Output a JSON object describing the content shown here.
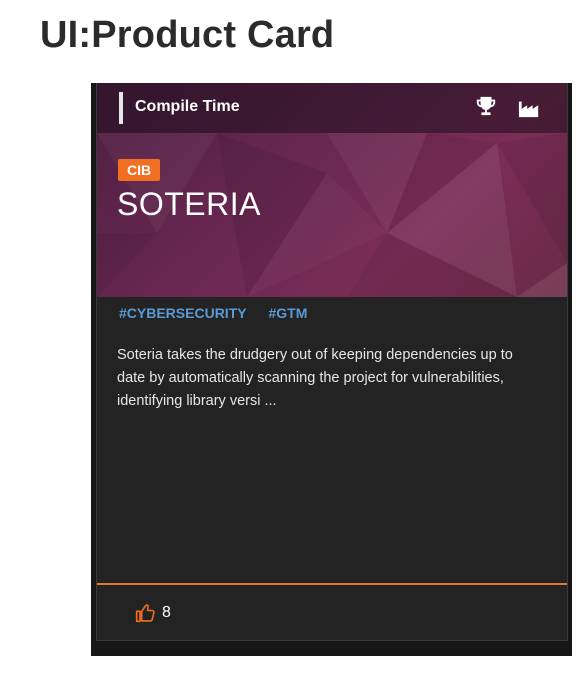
{
  "page": {
    "title": "UI:Product Card"
  },
  "card": {
    "category": "Compile Time",
    "icons": [
      "trophy-icon",
      "factory-icon",
      "thumbs-up-icon"
    ],
    "badge": "CIB",
    "name": "SOTERIA",
    "tags": [
      "#CYBERSECURITY",
      "#GTM"
    ],
    "description": "Soteria takes the drudgery out of keeping dependencies up to date by automatically scanning the project for vulnerabilities, identifying library versi ...",
    "likes": "8"
  },
  "colors": {
    "accent": "#f26f21",
    "tag": "#5b9bd5",
    "card_background": "#232323",
    "hero_gradient_start": "#4e1f42",
    "hero_gradient_end": "#7a2d55"
  }
}
